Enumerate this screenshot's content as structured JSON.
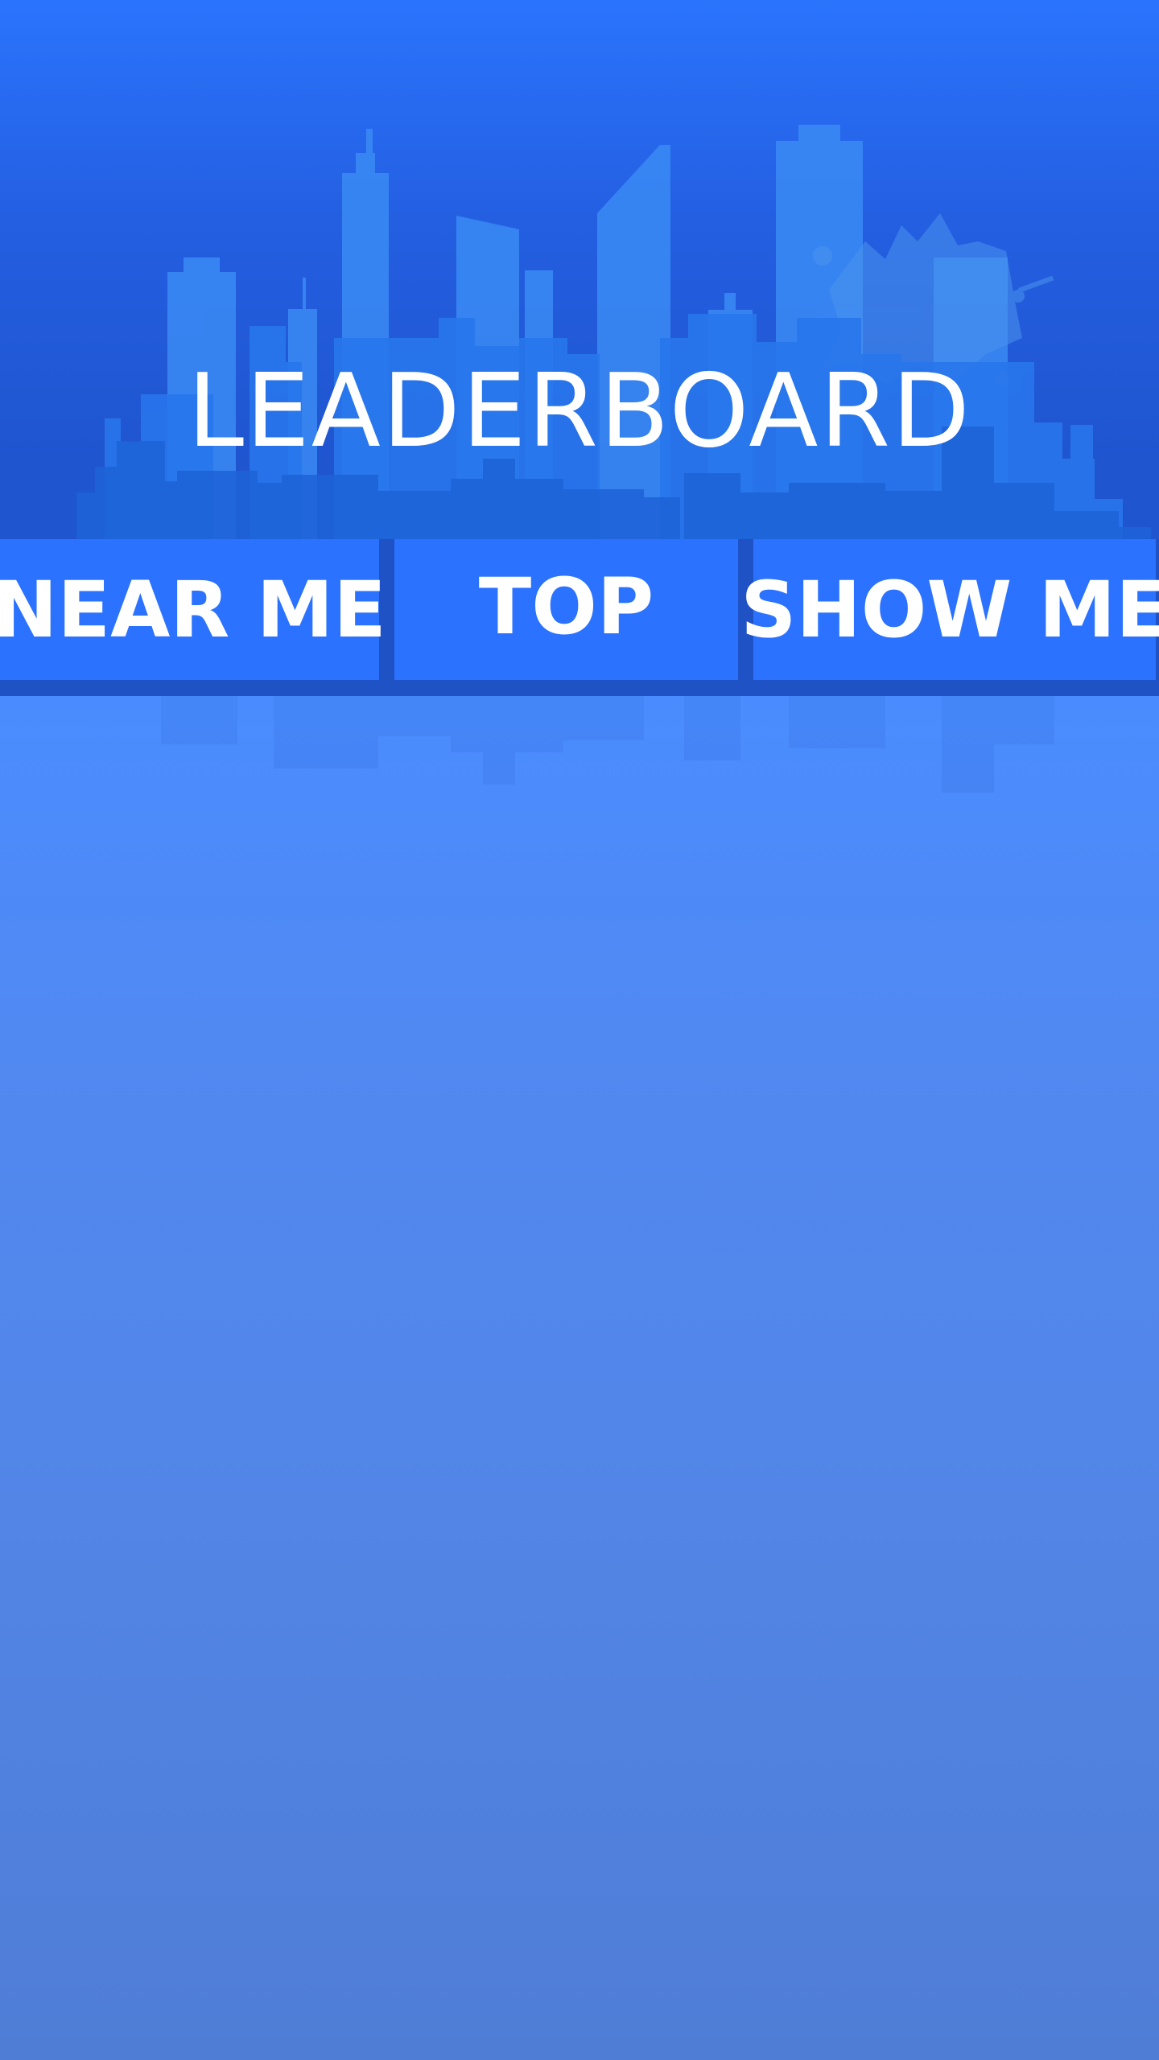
{
  "header": {
    "title": "LEADERBOARD"
  },
  "tabs": [
    {
      "label": "NEAR ME"
    },
    {
      "label": "TOP"
    },
    {
      "label": "SHOW ME"
    }
  ],
  "colors": {
    "header_top": "#2a74fd",
    "header_bottom": "#1f55cf",
    "tab_background": "#2a72ff",
    "tab_strip": "#1f52c4",
    "content_top": "#4a8cff",
    "content_bottom": "#4f7dd6",
    "text": "#ffffff"
  },
  "icons": {
    "skyline": "city-skyline-icon",
    "splash": "paint-splash-icon"
  }
}
